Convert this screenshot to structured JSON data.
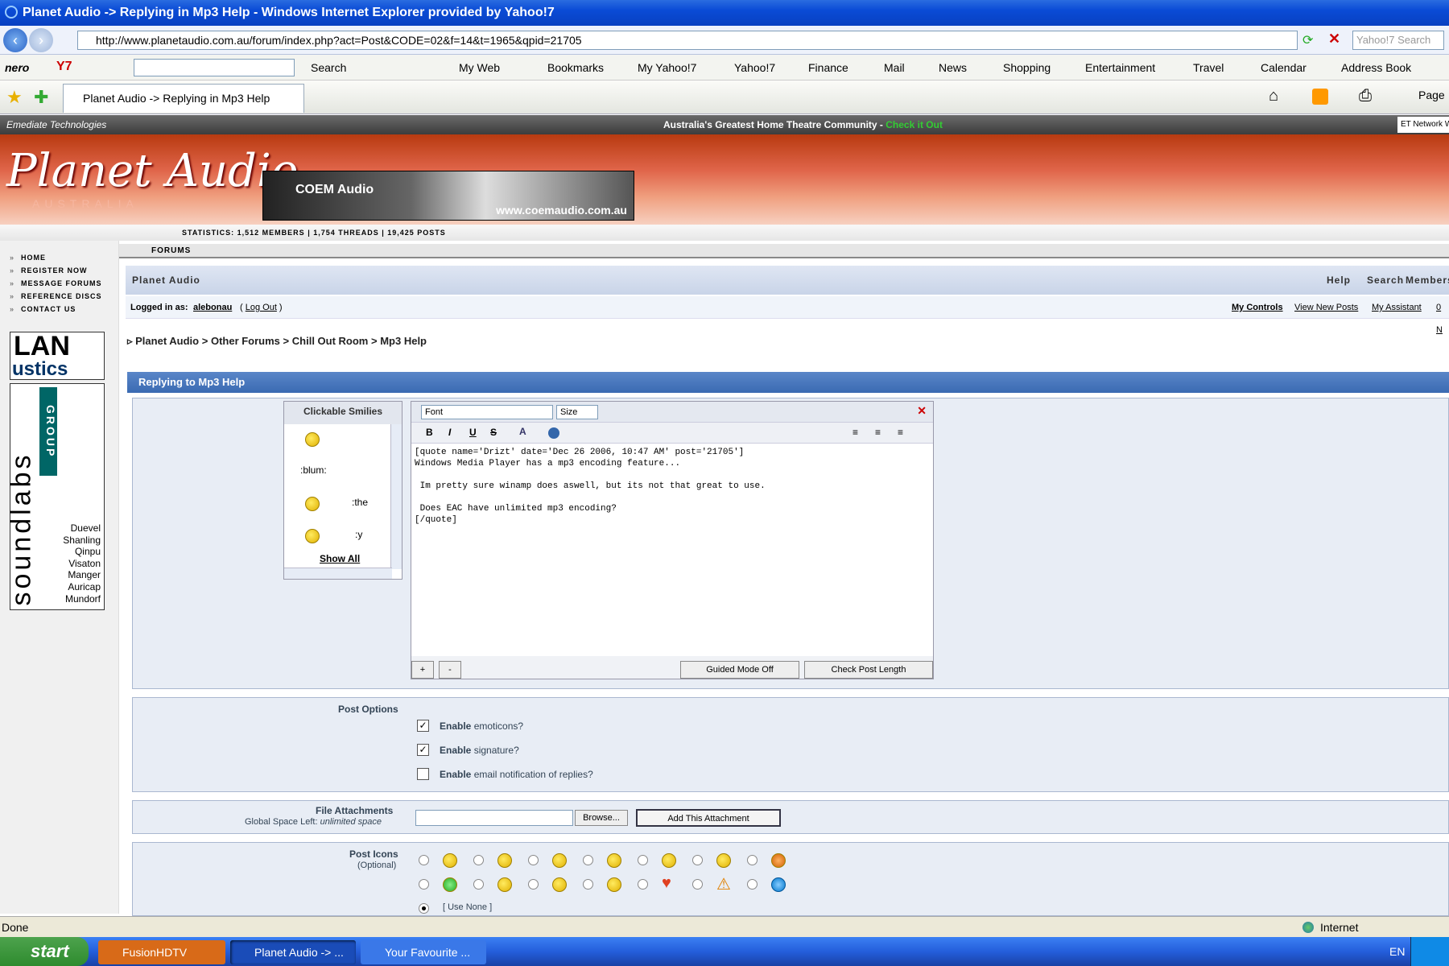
{
  "window": {
    "title": "Planet Audio -> Replying in Mp3 Help - Windows Internet Explorer provided by Yahoo!7"
  },
  "address": {
    "url": "http://www.planetaudio.com.au/forum/index.php?act=Post&CODE=02&f=14&t=1965&qpid=21705",
    "search_placeholder": "Yahoo!7 Search"
  },
  "toolbar": {
    "nero": "nero",
    "search": "Search",
    "items": [
      "My Web",
      "Bookmarks",
      "My Yahoo!7",
      "Yahoo!7",
      "Finance",
      "Mail",
      "News",
      "Shopping",
      "Entertainment",
      "Travel",
      "Calendar",
      "Address Book"
    ]
  },
  "tab": {
    "label": "Planet Audio -> Replying in Mp3 Help",
    "page": "Page"
  },
  "etbar": {
    "left": "Emediate Technologies",
    "center": "Australia's Greatest Home Theatre Community - ",
    "link": "Check it Out",
    "right": "ET Network W"
  },
  "banner": {
    "logo": "Planet Audio",
    "sub": "AUSTRALIA",
    "ad_text": "www.coemaudio.com.au",
    "ad_brand": "COEM Audio"
  },
  "stats": "STATISTICS: 1,512 MEMBERS | 1,754 THREADS | 19,425 POSTS",
  "leftnav": [
    "HOME",
    "REGISTER NOW",
    "MESSAGE FORUMS",
    "REFERENCE DISCS",
    "CONTACT US"
  ],
  "sidead": {
    "lan": "LAN",
    "ustics": "ustics",
    "soundlabs": "soundlabs",
    "group": "GROUP",
    "brands": [
      "Duevel",
      "Shanling",
      "Qinpu",
      "Visaton",
      "Manger",
      "Auricap",
      "Mundorf"
    ]
  },
  "forums_label": "FORUMS",
  "header": {
    "title": "Planet Audio",
    "links": [
      "Help",
      "Search",
      "Members"
    ]
  },
  "user": {
    "logged": "Logged in as:",
    "name": "alebonau",
    "logout": "Log Out",
    "links": [
      "My Controls",
      "View New Posts",
      "My Assistant",
      "0 N"
    ]
  },
  "breadcrumb": [
    "Planet Audio",
    ">",
    "Other Forums",
    ">",
    "Chill Out Room",
    ">",
    "Mp3 Help"
  ],
  "reply_title": "Replying to Mp3 Help",
  "smilies": {
    "title": "Clickable Smilies",
    "codes": [
      ":blum:",
      ":the",
      ":y"
    ],
    "show_all": "Show All"
  },
  "editor": {
    "font": "Font",
    "size": "Size",
    "body": "[quote name='Drizt' date='Dec 26 2006, 10:47 AM' post='21705']\nWindows Media Player has a mp3 encoding feature...\n\n Im pretty sure winamp does aswell, but its not that great to use.\n\n Does EAC have unlimited mp3 encoding?\n[/quote]",
    "plus": "+",
    "minus": "-",
    "guided": "Guided Mode Off",
    "check": "Check Post Length"
  },
  "post_options": {
    "title": "Post Options",
    "opts": [
      {
        "bold": "Enable",
        "rest": "emoticons?",
        "checked": true
      },
      {
        "bold": "Enable",
        "rest": "signature?",
        "checked": true
      },
      {
        "bold": "Enable",
        "rest": "email notification of replies?",
        "checked": false
      }
    ]
  },
  "attach": {
    "title": "File Attachments",
    "space_label": "Global Space Left:",
    "space": "unlimited space",
    "browse": "Browse...",
    "add": "Add This Attachment"
  },
  "icons": {
    "title": "Post Icons",
    "optional": "(Optional)",
    "none": "[ Use None ]"
  },
  "status": {
    "left": "Done",
    "zone": "Internet"
  },
  "taskbar": {
    "start": "start",
    "tasks": [
      "FusionHDTV",
      "Planet Audio -> ...",
      "Your Favourite ..."
    ],
    "lang": "EN"
  }
}
